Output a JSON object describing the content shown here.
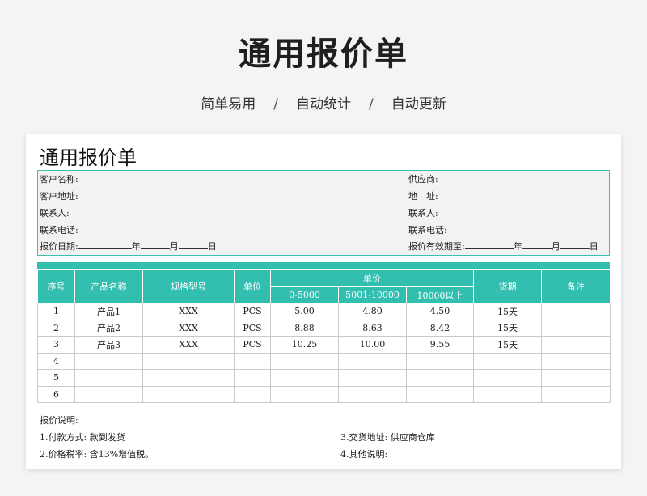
{
  "hero": {
    "title": "通用报价单",
    "tags": [
      "简单易用",
      "自动统计",
      "自动更新"
    ],
    "separator": "/"
  },
  "sheet": {
    "title": "通用报价单",
    "info_left": [
      "客户名称:",
      "客户地址:",
      "联系人:",
      "联系电话:"
    ],
    "info_right": [
      "供应商:",
      "地　址:",
      "联系人:",
      "联系电话:"
    ],
    "date_left": {
      "label": "报价日期:",
      "year": "年",
      "month": "月",
      "day": "日"
    },
    "date_right": {
      "label": "报价有效期至:",
      "year": "年",
      "month": "月",
      "day": "日"
    },
    "table": {
      "headers": {
        "seq": "序号",
        "name": "产品名称",
        "spec": "规格型号",
        "unit": "单位",
        "price": "单价",
        "tiers": [
          "0-5000",
          "5001-10000",
          "10000以上"
        ],
        "delivery": "货期",
        "remark": "备注"
      },
      "rows": [
        [
          "1",
          "产品1",
          "XXX",
          "PCS",
          "5.00",
          "4.80",
          "4.50",
          "15天",
          ""
        ],
        [
          "2",
          "产品2",
          "XXX",
          "PCS",
          "8.88",
          "8.63",
          "8.42",
          "15天",
          ""
        ],
        [
          "3",
          "产品3",
          "XXX",
          "PCS",
          "10.25",
          "10.00",
          "9.55",
          "15天",
          ""
        ],
        [
          "4",
          "",
          "",
          "",
          "",
          "",
          "",
          "",
          ""
        ],
        [
          "5",
          "",
          "",
          "",
          "",
          "",
          "",
          "",
          ""
        ],
        [
          "6",
          "",
          "",
          "",
          "",
          "",
          "",
          "",
          ""
        ]
      ]
    },
    "notes": {
      "heading": "报价说明:",
      "items": [
        "1.付款方式: 款到发货",
        "3.交货地址: 供应商仓库",
        "2.价格税率: 含13%增值税。",
        "4.其他说明:"
      ]
    }
  },
  "colors": {
    "accent": "#33bfb0",
    "border": "#3dbfb0"
  }
}
